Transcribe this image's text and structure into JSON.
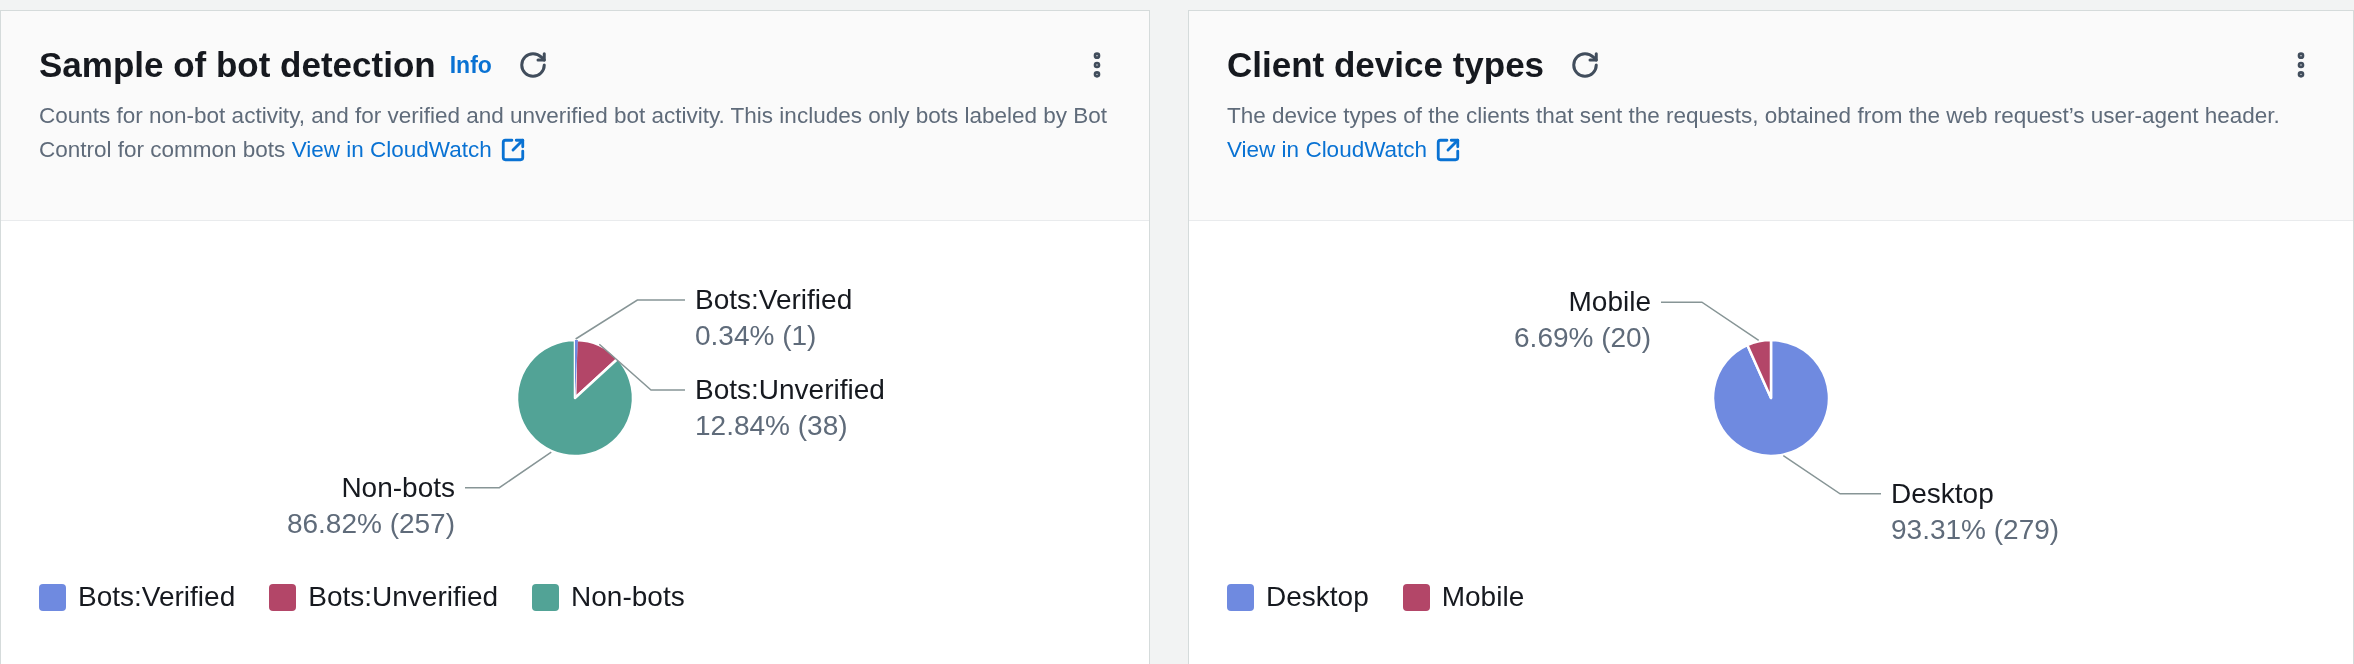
{
  "widgets": [
    {
      "title": "Sample of bot detection",
      "info": "Info",
      "description": "Counts for non-bot activity, and for verified and unverified bot activity. This includes only bots labeled by Bot Control for common bots",
      "link": "View in CloudWatch",
      "chart_data": {
        "type": "pie",
        "categories": [
          "Bots:Verified",
          "Bots:Unverified",
          "Non-bots"
        ],
        "values": [
          1,
          38,
          257
        ],
        "value_labels": [
          "0.34% (1)",
          "12.84% (38)",
          "86.82% (257)"
        ]
      },
      "legend": [
        {
          "label": "Bots:Verified",
          "color": "#6f8ae0"
        },
        {
          "label": "Bots:Unverified",
          "color": "#b34668"
        },
        {
          "label": "Non-bots",
          "color": "#52a396"
        }
      ]
    },
    {
      "title": "Client device types",
      "description": "The device types of the clients that sent the requests, obtained from the web request’s user-agent header.",
      "link": "View in CloudWatch",
      "chart_data": {
        "type": "pie",
        "categories": [
          "Desktop",
          "Mobile"
        ],
        "values": [
          279,
          20
        ],
        "value_labels": [
          "93.31% (279)",
          "6.69% (20)"
        ]
      },
      "legend": [
        {
          "label": "Desktop",
          "color": "#6f8ae0"
        },
        {
          "label": "Mobile",
          "color": "#b34668"
        }
      ]
    }
  ]
}
